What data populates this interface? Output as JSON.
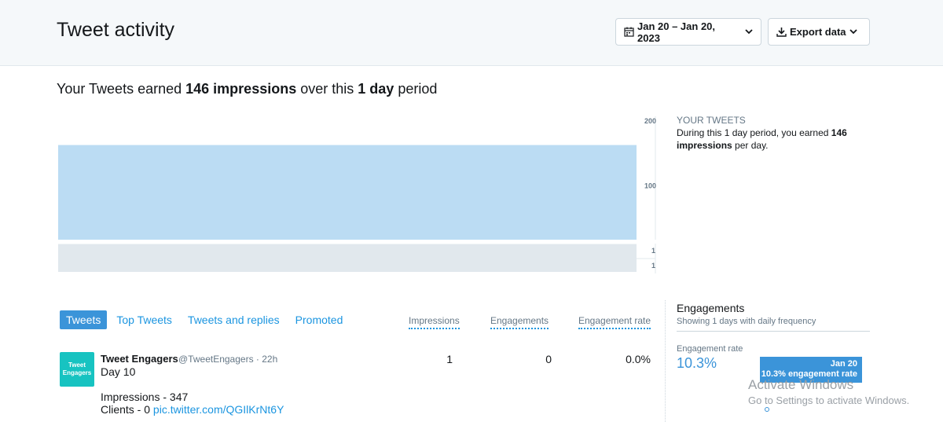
{
  "header": {
    "title": "Tweet activity",
    "date_range_label": "Jan 20 – Jan 20, 2023",
    "export_label": "Export data"
  },
  "summary": {
    "prefix": "Your Tweets earned",
    "impressions": "146 impressions",
    "middle": "over this",
    "period": "1 day",
    "suffix": "period"
  },
  "chart_data": {
    "type": "bar",
    "categories": [
      "Jan 20"
    ],
    "series": [
      {
        "name": "impressions",
        "values": [
          146
        ]
      }
    ],
    "y_ticks": [
      "200",
      "100"
    ],
    "ylim": [
      0,
      200
    ],
    "secondary_bars": [
      {
        "label": "1",
        "value": 1
      },
      {
        "label": "1",
        "value": 1
      }
    ],
    "grid": false,
    "colors": {
      "primary": "#bbdcf3",
      "secondary": "#e1e8ed"
    }
  },
  "sidebar": {
    "heading": "YOUR TWEETS",
    "text_prefix": "During this 1 day period, you earned",
    "impressions_bold": "146 impressions",
    "text_suffix": "per day."
  },
  "tabs": [
    {
      "label": "Tweets",
      "active": true
    },
    {
      "label": "Top Tweets",
      "active": false
    },
    {
      "label": "Tweets and replies",
      "active": false
    },
    {
      "label": "Promoted",
      "active": false
    }
  ],
  "table": {
    "columns": [
      "Impressions",
      "Engagements",
      "Engagement rate"
    ],
    "rows": [
      {
        "avatar_text": "Tweet Engagers",
        "name": "Tweet Engagers",
        "handle": "@TweetEngagers · 22h",
        "line1": "Day 10",
        "line2": "Impressions - 347",
        "line3_prefix": "Clients - 0",
        "line3_link": "pic.twitter.com/QGIlKrNt6Y",
        "impressions": "1",
        "engagements": "0",
        "engagement_rate": "0.0%"
      }
    ]
  },
  "engagements": {
    "title": "Engagements",
    "subtitle": "Showing 1 days with daily frequency",
    "rate_label": "Engagement rate",
    "rate_value": "10.3%",
    "tooltip_date": "Jan 20",
    "tooltip_value": "10.3% engagement rate"
  },
  "watermark": {
    "line1": "Activate Windows",
    "line2": "Go to Settings to activate Windows."
  },
  "colors": {
    "accent": "#1b95e0",
    "active_tab": "#3b94d9",
    "avatar": "#17c3c1"
  }
}
